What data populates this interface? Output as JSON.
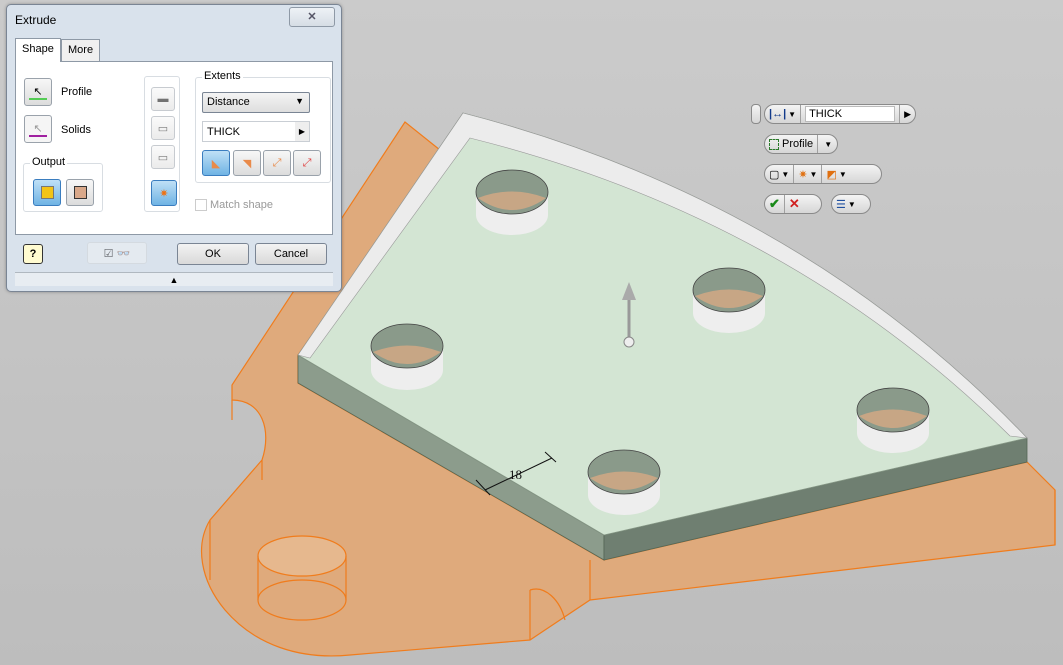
{
  "dialog": {
    "title": "Extrude",
    "close_icon": "close-icon",
    "tabs": [
      {
        "label": "Shape",
        "active": true
      },
      {
        "label": "More",
        "active": false
      }
    ],
    "profile_label": "Profile",
    "solids_label": "Solids",
    "output_label": "Output",
    "output_options": [
      {
        "icon": "solid-output-icon",
        "active": true
      },
      {
        "icon": "surface-output-icon",
        "active": false
      }
    ],
    "operation_buttons": [
      "join-icon",
      "cut-icon",
      "intersect-icon",
      "new-solid-icon"
    ],
    "extents_label": "Extents",
    "extents_type": "Distance",
    "distance_value": "THICK",
    "direction_buttons": [
      "direction-1-icon",
      "direction-2-icon",
      "symmetric-icon",
      "asymmetric-icon"
    ],
    "match_shape_label": "Match shape",
    "match_shape_checked": false,
    "preview_checked": true,
    "ok_label": "OK",
    "cancel_label": "Cancel"
  },
  "minitoolbar": {
    "distance_value": "THICK",
    "profile_label": "Profile"
  },
  "viewport": {
    "dimension_label": "18",
    "colors": {
      "background": "#c4c4c4",
      "base_part": "#dfaa7c",
      "base_edge": "#f07c1c",
      "preview_top": "#d3e5d3",
      "preview_side": "#7d8e7f"
    }
  }
}
